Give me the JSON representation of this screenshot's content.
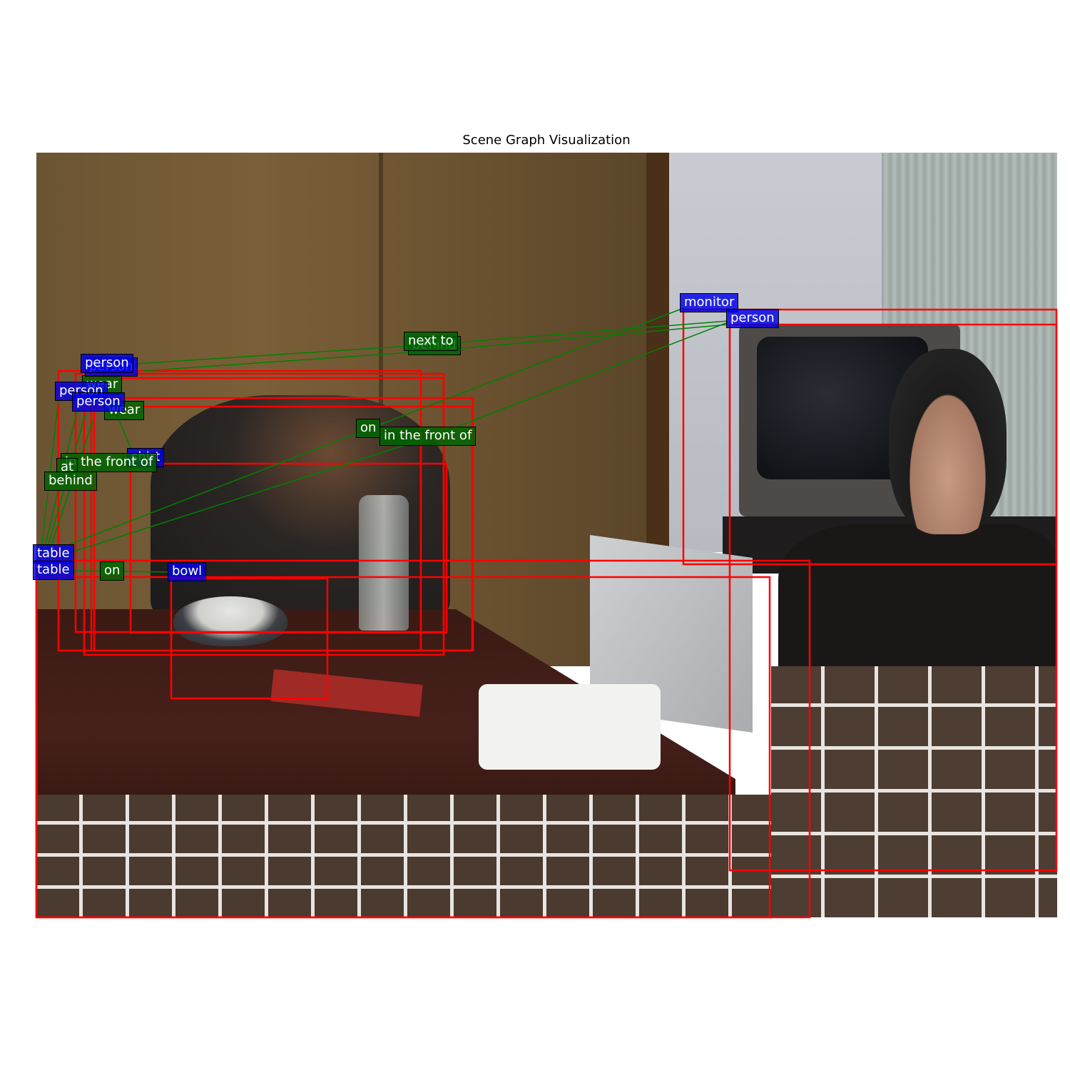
{
  "title": "Scene Graph Visualization",
  "colors": {
    "bbox": "#ff0000",
    "node_label": "#0000e6",
    "relation_label": "#006400",
    "edge": "#008000",
    "label_text": "#ffffff"
  },
  "nodes": [
    {
      "label": "monitor"
    },
    {
      "label": "person"
    },
    {
      "label": "person"
    },
    {
      "label": "person"
    },
    {
      "label": "person"
    },
    {
      "label": "person"
    },
    {
      "label": "table"
    },
    {
      "label": "table"
    },
    {
      "label": "bowl"
    },
    {
      "label": "shirt"
    }
  ],
  "relations": [
    {
      "label": "next to"
    },
    {
      "label": "behind"
    },
    {
      "label": "wear"
    },
    {
      "label": "wear"
    },
    {
      "label": "on"
    },
    {
      "label": "in the front of"
    },
    {
      "label": "in the front of"
    },
    {
      "label": "at"
    },
    {
      "label": "behind"
    },
    {
      "label": "on"
    }
  ]
}
